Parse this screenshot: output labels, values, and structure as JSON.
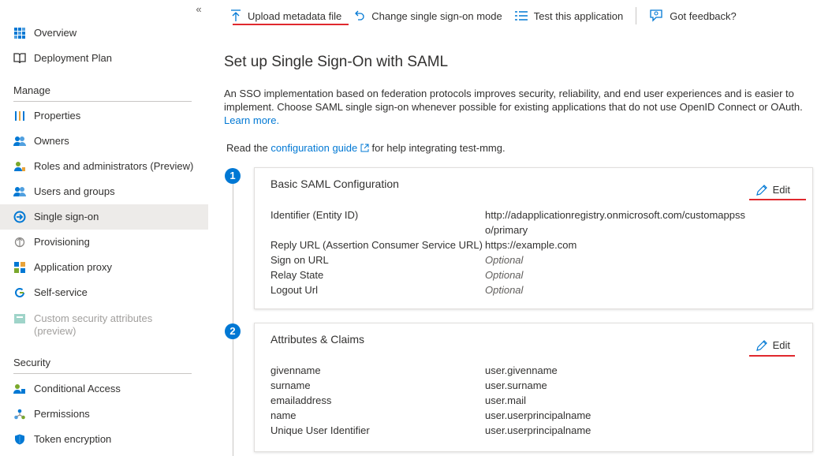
{
  "sidebar": {
    "collapse_glyph": "«",
    "top_items": [
      {
        "label": "Overview",
        "icon": "overview-grid-icon"
      },
      {
        "label": "Deployment Plan",
        "icon": "book-icon"
      }
    ],
    "manage_heading": "Manage",
    "manage_items": [
      {
        "label": "Properties",
        "icon": "properties-bars-icon"
      },
      {
        "label": "Owners",
        "icon": "owners-icon"
      },
      {
        "label": "Roles and administrators (Preview)",
        "icon": "roles-icon"
      },
      {
        "label": "Users and groups",
        "icon": "users-groups-icon"
      },
      {
        "label": "Single sign-on",
        "icon": "single-sign-on-icon",
        "active": true
      },
      {
        "label": "Provisioning",
        "icon": "provisioning-icon"
      },
      {
        "label": "Application proxy",
        "icon": "app-proxy-icon"
      },
      {
        "label": "Self-service",
        "icon": "self-service-icon"
      },
      {
        "label": "Custom security attributes (preview)",
        "icon": "custom-attributes-icon",
        "disabled": true
      }
    ],
    "security_heading": "Security",
    "security_items": [
      {
        "label": "Conditional Access",
        "icon": "conditional-access-icon"
      },
      {
        "label": "Permissions",
        "icon": "permissions-icon"
      },
      {
        "label": "Token encryption",
        "icon": "shield-icon"
      }
    ]
  },
  "toolbar": {
    "upload": "Upload metadata file",
    "change_mode": "Change single sign-on mode",
    "test": "Test this application",
    "feedback": "Got feedback?"
  },
  "main": {
    "title": "Set up Single Sign-On with SAML",
    "intro": "An SSO implementation based on federation protocols improves security, reliability, and end user experiences and is easier to implement. Choose SAML single sign-on whenever possible for existing applications that do not use OpenID Connect or OAuth.",
    "learn_more": "Learn more.",
    "read_prefix": "Read the",
    "guide_link": "configuration guide",
    "read_suffix": "for help integrating test-mmg."
  },
  "cards": [
    {
      "step": "1",
      "title": "Basic SAML Configuration",
      "edit": "Edit",
      "rows": [
        {
          "k": "Identifier (Entity ID)",
          "v": "http://adapplicationregistry.onmicrosoft.com/customappsso/primary",
          "optional": false
        },
        {
          "k": "Reply URL (Assertion Consumer Service URL)",
          "v": "https://example.com",
          "optional": false
        },
        {
          "k": "Sign on URL",
          "v": "Optional",
          "optional": true
        },
        {
          "k": "Relay State",
          "v": "Optional",
          "optional": true
        },
        {
          "k": "Logout Url",
          "v": "Optional",
          "optional": true
        }
      ]
    },
    {
      "step": "2",
      "title": "Attributes & Claims",
      "edit": "Edit",
      "rows": [
        {
          "k": "givenname",
          "v": "user.givenname",
          "optional": false
        },
        {
          "k": "surname",
          "v": "user.surname",
          "optional": false
        },
        {
          "k": "emailaddress",
          "v": "user.mail",
          "optional": false
        },
        {
          "k": "name",
          "v": "user.userprincipalname",
          "optional": false
        },
        {
          "k": "Unique User Identifier",
          "v": "user.userprincipalname",
          "optional": false
        }
      ]
    }
  ],
  "colors": {
    "accent": "#0078d4",
    "annotation": "#e0282e",
    "active_bg": "#edebe9"
  }
}
